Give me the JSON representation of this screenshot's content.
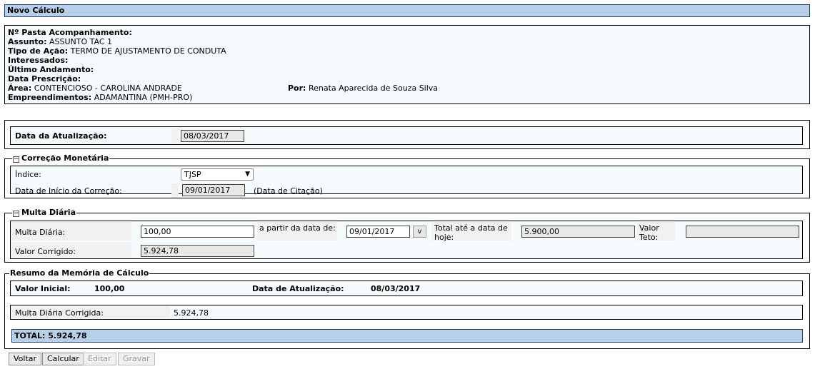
{
  "page": {
    "title": "Novo Cálculo"
  },
  "info": {
    "pasta_label": "Nº Pasta Acompanhamento:",
    "pasta_value": "",
    "assunto_label": "Assunto:",
    "assunto_value": "ASSUNTO TAC 1",
    "tipo_acao_label": "Tipo de Ação:",
    "tipo_acao_value": "TERMO DE AJUSTAMENTO DE CONDUTA",
    "interessados_label": "Interessados:",
    "ultimo_andamento_label": "Último Andamento:",
    "data_prescricao_label": "Data Prescrição:",
    "area_label": "Área:",
    "area_value": "CONTENCIOSO - CAROLINA ANDRADE",
    "por_label": "Por:",
    "por_value": "Renata Aparecida de Souza Silva",
    "empreendimentos_label": "Empreendimentos:",
    "empreendimentos_value": "ADAMANTINA (PMH-PRO)"
  },
  "atualizacao": {
    "label": "Data da Atualização:",
    "value": "08/03/2017"
  },
  "correcao": {
    "legend": "Correção Monetária",
    "toggle": "−",
    "indice_label": "Índice:",
    "indice_value": "TJSP",
    "inicio_label": "Data de Início da Correção:",
    "inicio_value": "09/01/2017",
    "inicio_note": "(Data de Citação)"
  },
  "multa": {
    "legend": "Multa Diária",
    "toggle": "−",
    "multa_label": "Multa Diária:",
    "multa_value": "100,00",
    "partir_label": "a partir da data de:",
    "partir_value": "09/01/2017",
    "partir_btn": "v",
    "total_label": "Total até a data de hoje:",
    "total_value": "5.900,00",
    "teto_label": "Valor Teto:",
    "teto_value": "",
    "corrigido_label": "Valor Corrigido:",
    "corrigido_value": "5.924,78"
  },
  "resumo": {
    "legend": "Resumo da Memória de Cálculo",
    "valor_inicial_label": "Valor Inicial:",
    "valor_inicial_value": "100,00",
    "data_atual_label": "Data de Atualização:",
    "data_atual_value": "08/03/2017",
    "multa_corr_label": "Multa Diária Corrigida:",
    "multa_corr_value": "5.924,78",
    "total_text": "TOTAL: 5.924,78"
  },
  "buttons": {
    "voltar": "Voltar",
    "calcular": "Calcular",
    "editar": "Editar",
    "gravar": "Gravar"
  },
  "colors": {
    "header_bg": "#b8cfe9",
    "panel_bg": "#f6fbfd",
    "readonly_bg": "#e8e8e4"
  }
}
